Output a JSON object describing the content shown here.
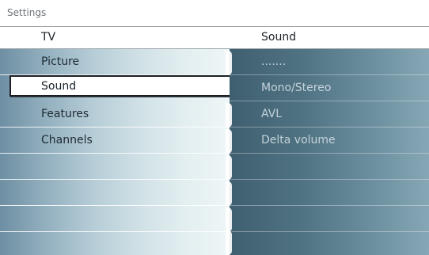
{
  "breadcrumb": "Settings",
  "header": {
    "left_title": "TV",
    "right_title": "Sound"
  },
  "menu": {
    "items": [
      {
        "label": "Picture"
      },
      {
        "label": "Sound"
      },
      {
        "label": "Features"
      },
      {
        "label": "Channels"
      },
      {
        "label": ""
      },
      {
        "label": ""
      },
      {
        "label": ""
      },
      {
        "label": ""
      }
    ],
    "selected_index": 1
  },
  "submenu": {
    "items": [
      {
        "label": "......."
      },
      {
        "label": "Mono/Stereo"
      },
      {
        "label": "AVL"
      },
      {
        "label": "Delta volume"
      },
      {
        "label": ""
      },
      {
        "label": ""
      },
      {
        "label": ""
      },
      {
        "label": ""
      }
    ]
  },
  "colors": {
    "selected_border": "#1b1f23",
    "selected_fill": "#ffffff",
    "left_pane_light": "#eef6f7",
    "right_pane_dark": "#3f5f70"
  }
}
